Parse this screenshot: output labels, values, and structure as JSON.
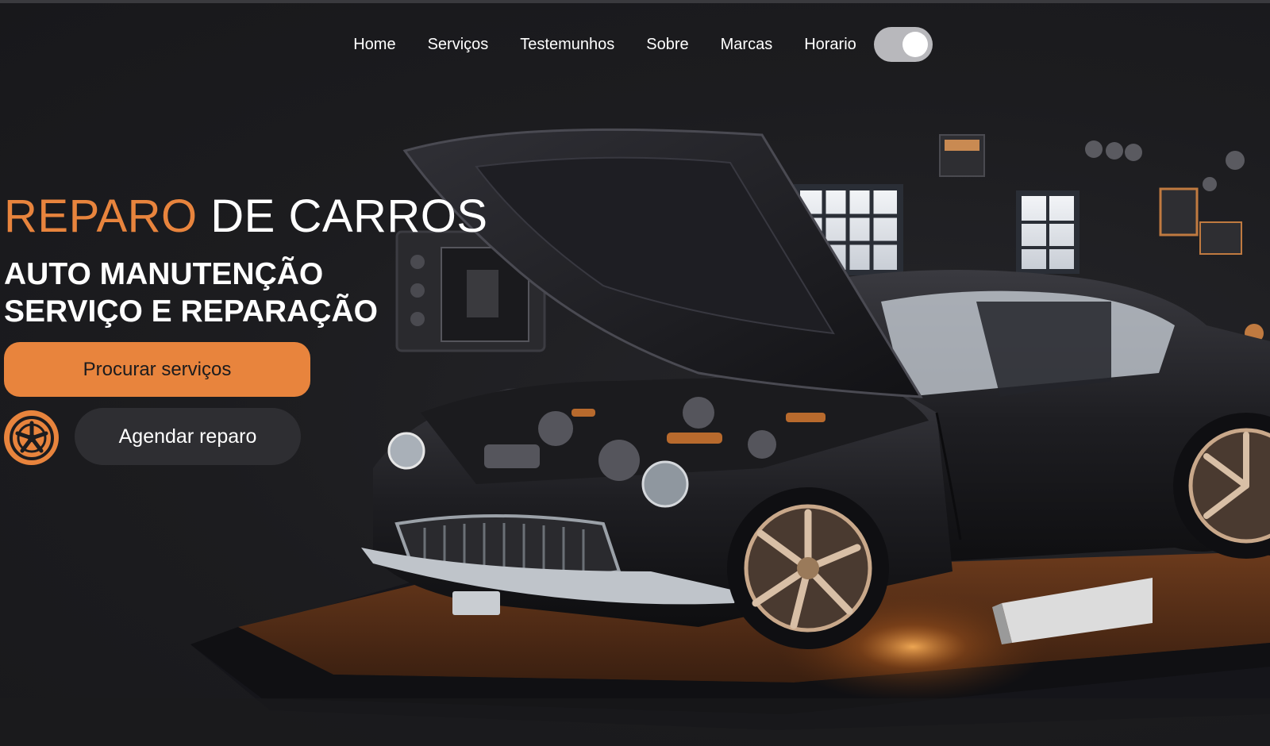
{
  "nav": {
    "items": [
      {
        "label": "Home"
      },
      {
        "label": "Serviços"
      },
      {
        "label": "Testemunhos"
      },
      {
        "label": "Sobre"
      },
      {
        "label": "Marcas"
      },
      {
        "label": "Horario"
      }
    ],
    "theme_toggle": {
      "state": "on"
    }
  },
  "hero": {
    "title_accent": "REPARO",
    "title_rest": "DE CARROS",
    "subtitle_line1": "AUTO MANUTENÇÃO",
    "subtitle_line2": "SERVIÇO E REPARAÇÃO",
    "primary_button": "Procurar serviços",
    "secondary_button": "Agendar reparo",
    "badge_icon": "wheel-icon",
    "image_subject": "car-with-open-hood-icon"
  },
  "colors": {
    "accent": "#e8843d",
    "background": "#1c1c1f",
    "button_dark": "#2e2e32",
    "toggle_track": "#b8b8bc"
  }
}
